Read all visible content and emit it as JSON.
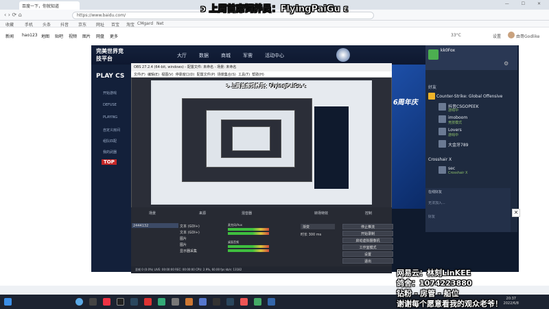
{
  "overlay_title": "ↄ 上周首席饲养员：FlyingPaiGu ɛ",
  "browser": {
    "tab_title": "百度一下，你就知道",
    "url": "https://www.baidu.com/",
    "bookmarks": [
      "收藏",
      "手机",
      "头条",
      "抖音",
      "京东",
      "网址",
      "百宝",
      "淘宝",
      "CMgard",
      "Net"
    ],
    "top_right": "查看   ",
    "weather": "33°C",
    "settings": "设置",
    "user": "由哥Godlike"
  },
  "baidu_nav": [
    "新闻",
    "hao123",
    "地图",
    "贴吧",
    "视频",
    "图片",
    "网盘",
    "更多"
  ],
  "game": {
    "logo": "完美世界竞技平台",
    "tabs": [
      "大厅",
      "数据",
      "商城",
      "军需",
      "活动中心"
    ],
    "play_label": "PLAY CS",
    "side_items": [
      "开始游戏",
      "DEFUSE",
      "PLAYING",
      "自定义房间",
      "组队匹配",
      "我的武器",
      "TOP"
    ],
    "banner_text": "6周年庆",
    "username": "kk0Fox",
    "group_label": "好友",
    "game_name": "Counter-Strike: Global Offensive",
    "friends": [
      {
        "name": "抖音CSGOPEEK",
        "status": "游戏中"
      },
      {
        "name": "imoboom",
        "status": "竞技模式"
      },
      {
        "name": "Lovers",
        "status": "游戏中"
      },
      {
        "name": "大金牙789",
        "status": "在线"
      },
      {
        "name": "Crosshair X",
        "status": ""
      },
      {
        "name": "sec",
        "status": "Crosshair X"
      }
    ],
    "chat_header": "在线好友",
    "chat_lines": [
      "无法加入...",
      "好友"
    ]
  },
  "obs": {
    "title": "OBS 27.2.4 (64-bit, windows) - 配置文件: 未命名 - 场景: 未命名",
    "menu": [
      "文件(F)",
      "编辑(E)",
      "视图(V)",
      "停靠窗口(D)",
      "配置文件(P)",
      "场景集合(S)",
      "工具(T)",
      "帮助(H)"
    ],
    "preview_overlay": "ↄ 上周首席饲养员：FlyingPaiGu ɛ",
    "panels": [
      "场景",
      "来源",
      "混音器",
      "转场特效",
      "控制"
    ],
    "scenes": [
      "2444132",
      "文本",
      "文本",
      "图片",
      "图片",
      "显示器采集"
    ],
    "sources": [
      "文本 (GDI+)",
      "文本 (GDI+)",
      "图片",
      "图片",
      "显示器采集"
    ],
    "mixer": [
      "麦克风/Aux",
      "桌面音频"
    ],
    "transition": [
      "渐变",
      "时长 300 ms"
    ],
    "controls": [
      "停止推流",
      "开始录制",
      "启动虚拟摄像机",
      "工作室模式",
      "设置",
      "退出"
    ],
    "status": "丢帧 0 (0.0%)   LIVE: 00:00:00   REC: 00:00:00   CPU: 2.9%, 60.00 fps   kb/s: 13182"
  },
  "streamer": {
    "line1": "网易云：林刻LinKEE",
    "line2": "鸽舍：1074223880",
    "line3": "钻粉 - 房管 - 船位",
    "line4": "谢谢每个愿意看我的观众老爷！"
  },
  "taskbar": {
    "time": "20:37",
    "date": "2022/6/8"
  }
}
